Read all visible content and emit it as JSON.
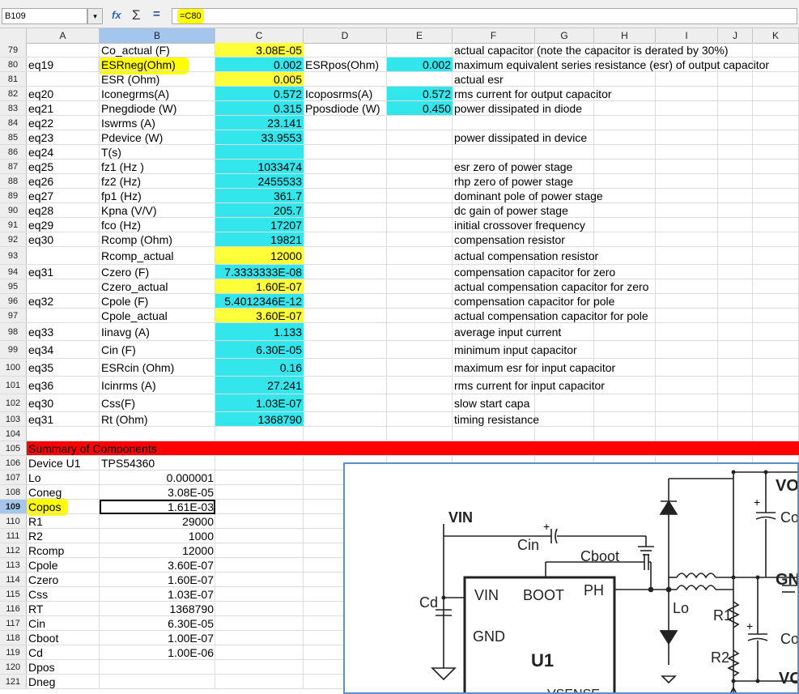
{
  "formula_bar": {
    "cell_ref": "B109",
    "formula": "=C80"
  },
  "columns": [
    "A",
    "B",
    "C",
    "D",
    "E",
    "F",
    "G",
    "H",
    "I",
    "J",
    "K"
  ],
  "colors": {
    "cyan": "#33e6ec",
    "yellow": "#ffff3a",
    "red": "#ff0000",
    "selection": "#a4c6ec"
  },
  "rows": [
    {
      "n": "79",
      "b": "Co_actual (F)",
      "c": "3.08E-05",
      "f": "actual capacitor (note the capacitor is derated by 30%)"
    },
    {
      "n": "80",
      "a": "eq19",
      "b": "ESRneg(Ohm)",
      "c": "0.002",
      "d": "ESRpos(Ohm)",
      "e": "0.002",
      "f": "maximum equivalent series resistance (esr) of output capacitor"
    },
    {
      "n": "81",
      "b": "ESR (Ohm)",
      "c": "0.005",
      "f": "actual esr"
    },
    {
      "n": "82",
      "a": "eq20",
      "b": "Iconegrms(A)",
      "c": "0.572",
      "d": "Icoposrms(A)",
      "e": "0.572",
      "f": "rms current for output capacitor"
    },
    {
      "n": "83",
      "a": "eq21",
      "b": "Pnegdiode (W)",
      "c": "0.315",
      "d": "Pposdiode (W)",
      "e": "0.450",
      "f": "power dissipated in diode"
    },
    {
      "n": "84",
      "a": "eq22",
      "b": "Iswrms (A)",
      "c": "23.141"
    },
    {
      "n": "85",
      "a": "eq23",
      "b": "Pdevice (W)",
      "c": "33.9553",
      "f": "power dissipated in device"
    },
    {
      "n": "86",
      "a": "eq24",
      "b": "T(s)"
    },
    {
      "n": "87",
      "a": "eq25",
      "b": "fz1 (Hz )",
      "c": "1033474",
      "f": "esr zero of power stage"
    },
    {
      "n": "88",
      "a": "eq26",
      "b": "fz2 (Hz)",
      "c": "2455533",
      "f": "rhp zero of power stage"
    },
    {
      "n": "89",
      "a": "eq27",
      "b": "fp1 (Hz)",
      "c": "361.7",
      "f": "dominant pole of power stage"
    },
    {
      "n": "90",
      "a": "eq28",
      "b": "Kpna (V/V)",
      "c": "205.7",
      "f": "dc gain of power stage"
    },
    {
      "n": "91",
      "a": "eq29",
      "b": "fco (Hz)",
      "c": "17207",
      "f": "initial crossover frequency"
    },
    {
      "n": "92",
      "a": "eq30",
      "b": "Rcomp (Ohm)",
      "c": "19821",
      "f": "compensation resistor"
    },
    {
      "n": "93",
      "b": "Rcomp_actual",
      "c": "12000",
      "f": "actual compensation resistor"
    },
    {
      "n": "94",
      "a": "eq31",
      "b": "Czero (F)",
      "c": "7.3333333E-08",
      "f": "compensation capacitor for zero"
    },
    {
      "n": "95",
      "b": "Czero_actual",
      "c": "1.60E-07",
      "f": "actual compensation capacitor for zero"
    },
    {
      "n": "96",
      "a": "eq32",
      "b": "Cpole (F)",
      "c": "5.4012346E-12",
      "f": "compensation capacitor for pole"
    },
    {
      "n": "97",
      "b": "Cpole_actual",
      "c": "3.60E-07",
      "f": "actual compensation capacitor for pole"
    },
    {
      "n": "98",
      "a": "eq33",
      "b": "Iinavg (A)",
      "c": "1.133",
      "f": "average input current"
    },
    {
      "n": "99",
      "a": "eq34",
      "b": "Cin (F)",
      "c": "6.30E-05",
      "f": "minimum input capacitor"
    },
    {
      "n": "100",
      "a": "eq35",
      "b": "ESRcin (Ohm)",
      "c": "0.16",
      "f": "maximum esr for input capacitor"
    },
    {
      "n": "101",
      "a": "eq36",
      "b": "Icinrms (A)",
      "c": "27.241",
      "f": "rms current for input capacitor"
    },
    {
      "n": "102",
      "a": "eq30",
      "b": "Css(F)",
      "c": "1.03E-07",
      "f": "slow start capa"
    },
    {
      "n": "103",
      "a": "eq31",
      "b": "Rt (Ohm)",
      "c": "1368790",
      "f": "timing resistance"
    },
    {
      "n": "104"
    },
    {
      "n": "105",
      "a": "Summary of Components"
    },
    {
      "n": "106",
      "a": "Device U1",
      "b": "TPS54360"
    },
    {
      "n": "107",
      "a": "Lo",
      "b": "0.000001"
    },
    {
      "n": "108",
      "a": "Coneg",
      "b": "3.08E-05"
    },
    {
      "n": "109",
      "a": "Copos",
      "b": "1.61E-03"
    },
    {
      "n": "110",
      "a": "R1",
      "b": "29000"
    },
    {
      "n": "111",
      "a": "R2",
      "b": "1000"
    },
    {
      "n": "112",
      "a": "Rcomp",
      "b": "12000"
    },
    {
      "n": "113",
      "a": "Cpole",
      "b": "3.60E-07"
    },
    {
      "n": "114",
      "a": "Czero",
      "b": "1.60E-07"
    },
    {
      "n": "115",
      "a": "Css",
      "b": "1.03E-07"
    },
    {
      "n": "116",
      "a": "RT",
      "b": "1368790"
    },
    {
      "n": "117",
      "a": "Cin",
      "b": "6.30E-05"
    },
    {
      "n": "118",
      "a": "Cboot",
      "b": "1.00E-07"
    },
    {
      "n": "119",
      "a": "Cd",
      "b": "1.00E-06"
    },
    {
      "n": "120",
      "a": "Dpos"
    },
    {
      "n": "121",
      "a": "Dneg"
    }
  ],
  "schematic": {
    "labels": {
      "vin": "VIN",
      "cin": "Cin",
      "cboot": "Cboot",
      "cd": "Cd",
      "u1_vin": "VIN",
      "u1_boot": "BOOT",
      "u1_ph": "PH",
      "u1_gnd": "GND",
      "u1": "U1",
      "lo": "Lo",
      "r1": "R1",
      "r2": "R2",
      "vo_top": "VO",
      "co": "Co",
      "gnd": "GN",
      "co2": "Co",
      "vo_bot": "VO",
      "vsense": "VSENSE"
    }
  }
}
